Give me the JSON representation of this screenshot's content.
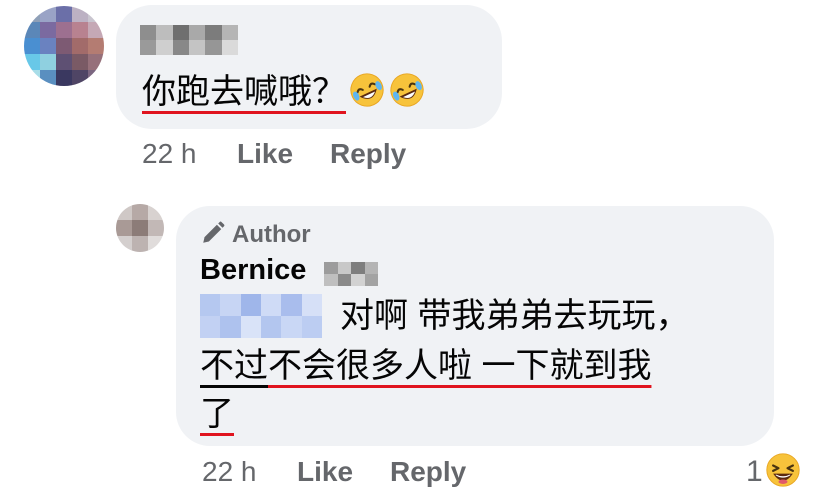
{
  "comment": {
    "text_plain": "你跑去喊哦？",
    "time": "22 h",
    "like_label": "Like",
    "reply_label": "Reply",
    "emojis": [
      "rofl-emoji",
      "rofl-emoji"
    ]
  },
  "reply": {
    "author_badge": "Author",
    "author_name": "Bernice",
    "line1": "对啊 带我弟弟去玩玩，",
    "line2_a": "不过",
    "line2_b": "不会很多人啦 一下就到我",
    "line3": "了",
    "time": "22 h",
    "like_label": "Like",
    "reply_label": "Reply",
    "reaction_count": "1",
    "reaction_icon": "laughing-emoji"
  },
  "colors": {
    "bubble": "#f0f2f5",
    "meta": "#65676b",
    "text": "#050505",
    "annotation_underline": "#e0141e"
  }
}
